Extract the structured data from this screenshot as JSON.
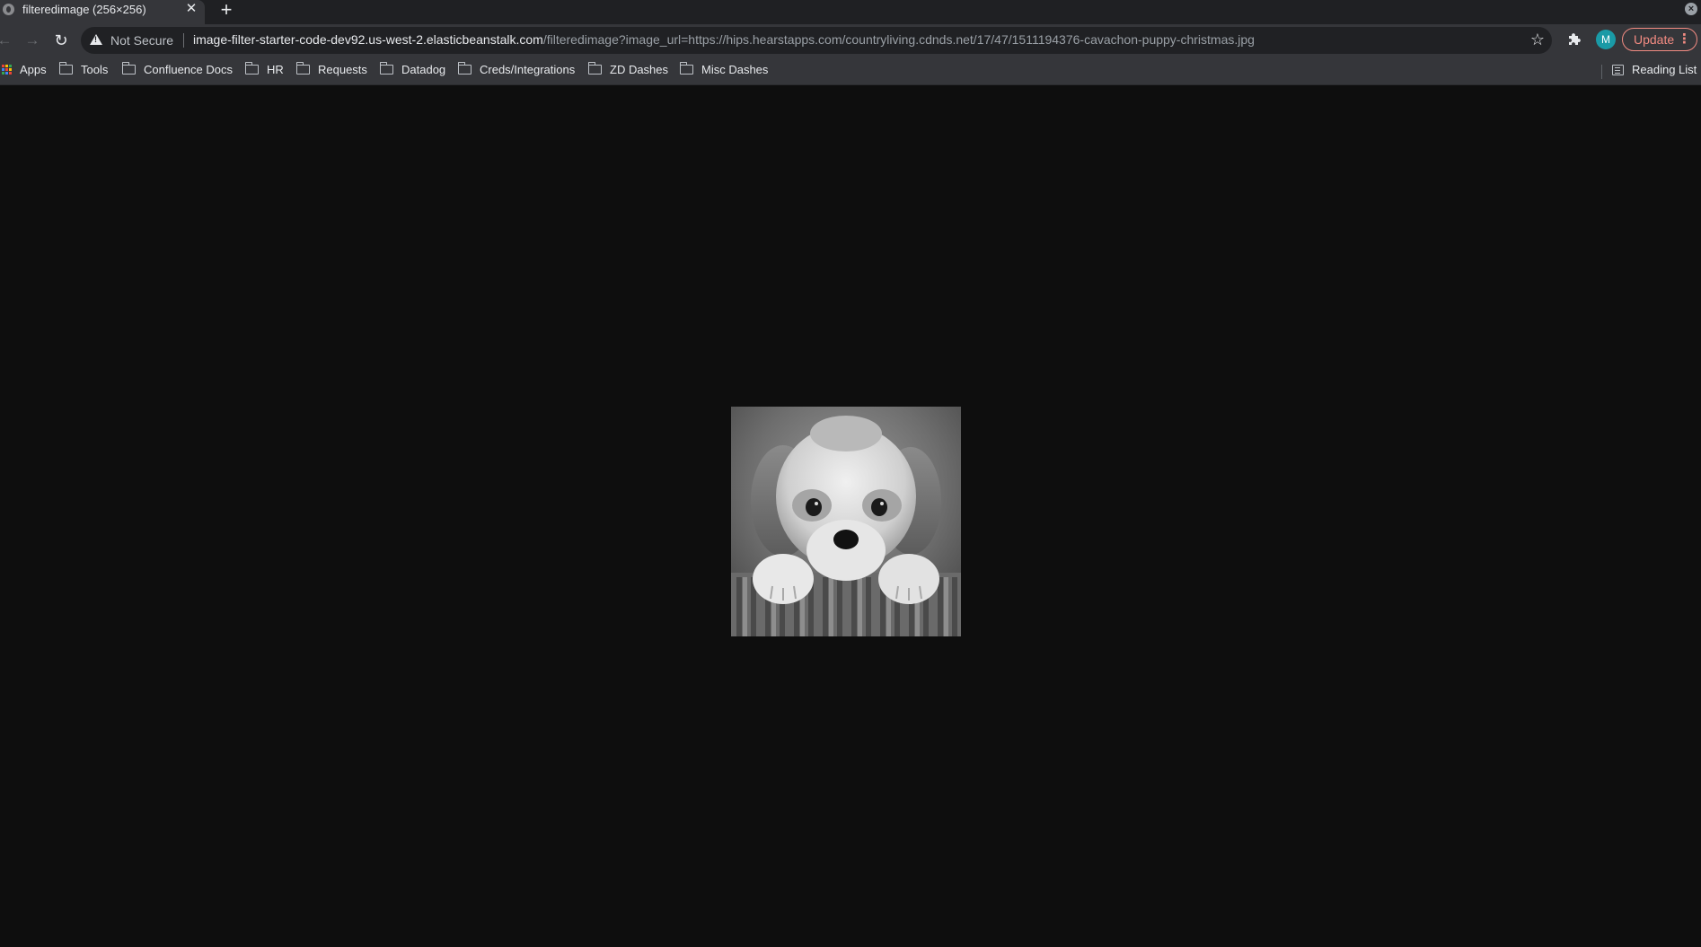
{
  "tab": {
    "title": "filteredimage (256×256)",
    "close_glyph": "✕",
    "new_tab_glyph": "+"
  },
  "toolbar": {
    "back_glyph": "←",
    "forward_glyph": "→",
    "reload_glyph": "↻",
    "security_label": "Not Secure",
    "url_host": "image-filter-starter-code-dev92.us-west-2.elasticbeanstalk.com",
    "url_path": "/filteredimage?image_url=https://hips.hearstapps.com/countryliving.cdnds.net/17/47/1511194376-cavachon-puppy-christmas.jpg",
    "bookmark_star_glyph": "☆",
    "avatar_letter": "M",
    "update_label": "Update",
    "update_menu_glyph": "⋮"
  },
  "bookmarks": {
    "apps": "Apps",
    "items": [
      "Tools",
      "Confluence Docs",
      "HR",
      "Requests",
      "Datadog",
      "Creds/Integrations",
      "ZD Dashes",
      "Misc Dashes"
    ],
    "reading_list": "Reading List"
  },
  "colors": {
    "page_background": "#0e0e0e",
    "toolbar": "#35363a",
    "omnibox": "#202124",
    "update_accent": "#f28b82",
    "avatar": "#1a9aa6"
  },
  "icons": [
    "site-info-icon",
    "close-icon",
    "plus-icon",
    "back-arrow-icon",
    "forward-arrow-icon",
    "reload-icon",
    "warning-icon",
    "star-icon",
    "puzzle-extension-icon",
    "apps-grid-icon",
    "folder-icon",
    "reading-list-icon",
    "kebab-menu-icon"
  ]
}
